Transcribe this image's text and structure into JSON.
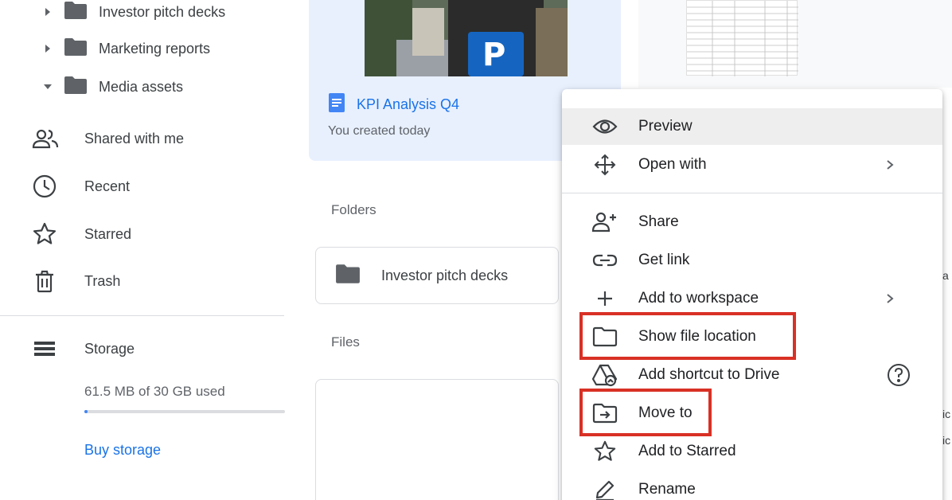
{
  "sidebar": {
    "tree": [
      {
        "label": "Investor pitch decks",
        "expanded": false
      },
      {
        "label": "Marketing reports",
        "expanded": false
      },
      {
        "label": "Media assets",
        "expanded": true
      }
    ],
    "nav": [
      {
        "label": "Shared with me",
        "icon": "people-icon"
      },
      {
        "label": "Recent",
        "icon": "clock-icon"
      },
      {
        "label": "Starred",
        "icon": "star-icon"
      },
      {
        "label": "Trash",
        "icon": "trash-icon"
      }
    ],
    "storage": {
      "label": "Storage",
      "usage_text": "61.5 MB of 30 GB used",
      "used_fraction": 0.002,
      "buy_label": "Buy storage"
    }
  },
  "main": {
    "suggested_card": {
      "title": "KPI Analysis Q4",
      "subtitle": "You created today",
      "thumbnail_sign": "P"
    },
    "folders_label": "Folders",
    "folder_card": {
      "label": "Investor pitch decks"
    },
    "files_label": "Files"
  },
  "context_menu": {
    "items": [
      {
        "label": "Preview",
        "icon": "eye-icon",
        "hovered": true
      },
      {
        "label": "Open with",
        "icon": "move-arrows-icon",
        "submenu": true
      },
      {
        "label": "Share",
        "icon": "add-person-icon"
      },
      {
        "label": "Get link",
        "icon": "link-icon"
      },
      {
        "label": "Add to workspace",
        "icon": "plus-icon",
        "submenu": true
      },
      {
        "label": "Show file location",
        "icon": "folder-outline-icon",
        "highlighted": true
      },
      {
        "label": "Add shortcut to Drive",
        "icon": "drive-shortcut-icon",
        "help": true
      },
      {
        "label": "Move to",
        "icon": "move-folder-icon",
        "highlighted": true
      },
      {
        "label": "Add to Starred",
        "icon": "star-outline-icon"
      },
      {
        "label": "Rename",
        "icon": "pencil-icon"
      }
    ]
  },
  "colors": {
    "accent": "#1a73e8",
    "highlight_border": "#d93025",
    "selected_card_bg": "#e8f0fe",
    "folder_icon": "#5f6368"
  }
}
